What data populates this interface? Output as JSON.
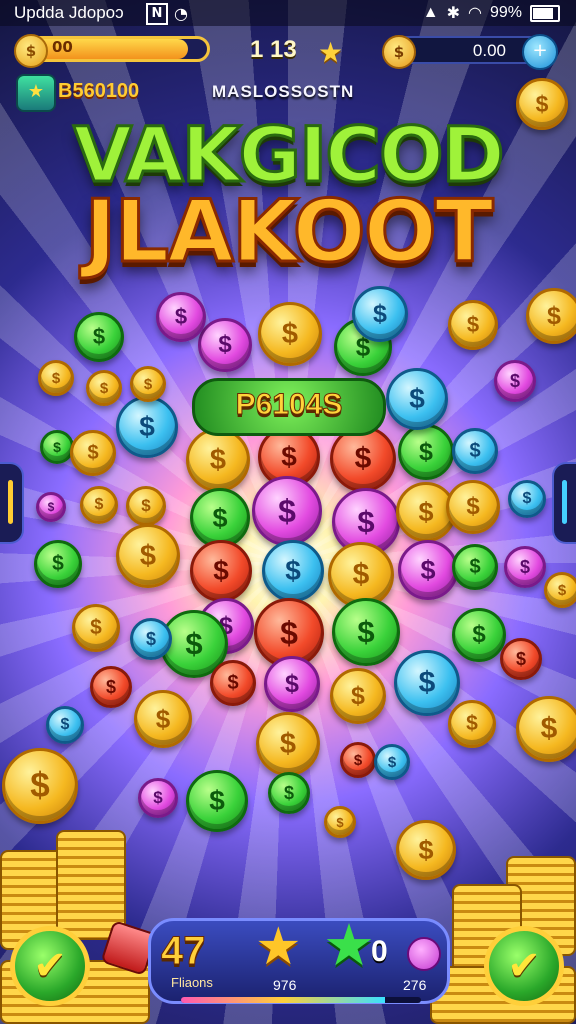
{
  "status_bar": {
    "time": "Updda Jdopoɔ",
    "n_icon": "N",
    "right_text": "99%"
  },
  "hud": {
    "xp_text": "00",
    "xp_fill_fraction": 0.9,
    "level": "1 13",
    "balance": "0.00",
    "balance_plus": "+"
  },
  "gems": {
    "value": "B560100"
  },
  "banner_text": "MASLOSSOSTN",
  "title": {
    "line1": "VAKGICOD",
    "line2": "JLAKOOT"
  },
  "prize": "P6104S",
  "bottom": {
    "count": "47",
    "count_label": "Fliaons",
    "zero": "0",
    "value1": "976",
    "value2": "276",
    "progress_fraction": 0.85,
    "confirm_left": "✔",
    "confirm_right": "✔"
  },
  "colors": {
    "accent_gold": "#ffcf3a",
    "accent_green": "#3ad23a",
    "panel_blue": "#1b2270"
  },
  "icons": [
    "coin-icon",
    "star-icon",
    "plus-icon",
    "gem-icon",
    "check-icon",
    "wifi-icon",
    "battery-icon"
  ]
}
